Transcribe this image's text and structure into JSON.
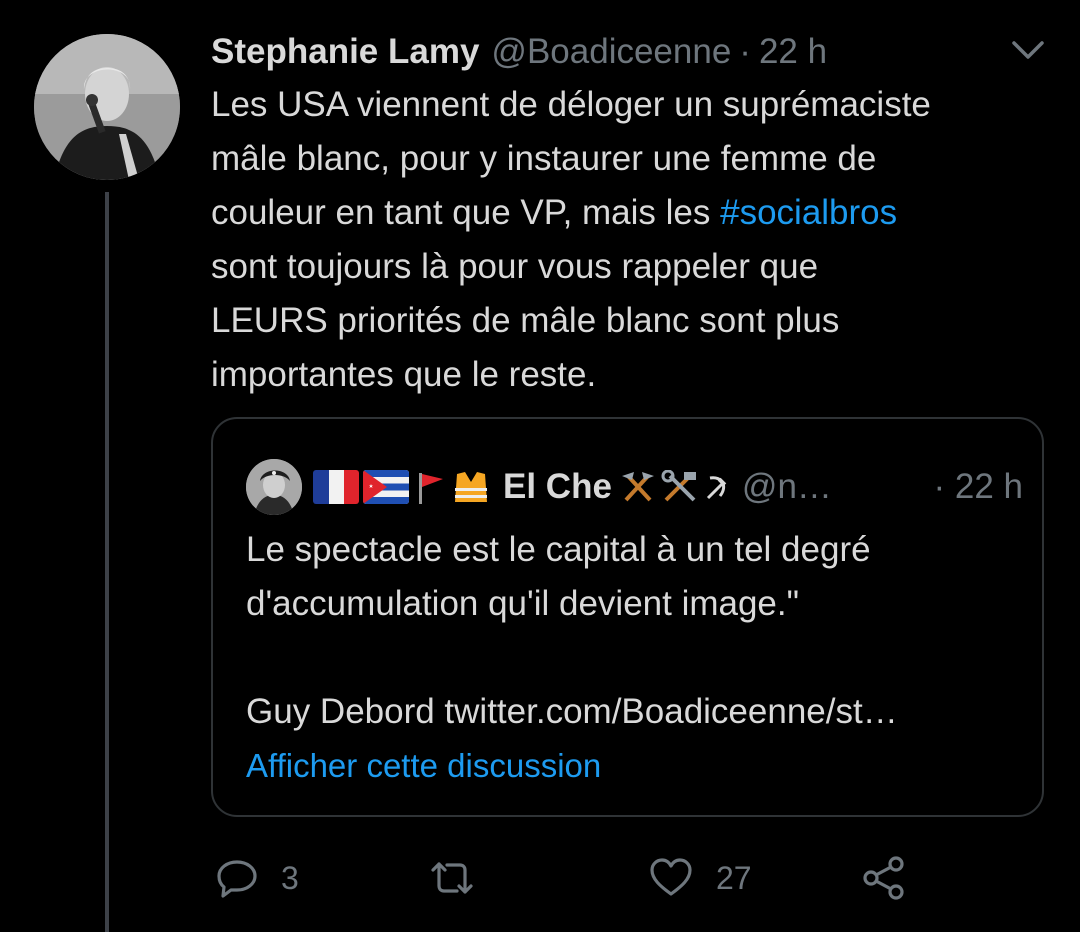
{
  "tweet": {
    "display_name": "Stephanie Lamy",
    "handle": "@Boadiceenne",
    "separator": "·",
    "time": "22 h",
    "text_lines": [
      "Les USA viennent de déloger un suprémaciste",
      "mâle blanc, pour y instaurer une femme de",
      "couleur en tant que VP, mais les ",
      "sont toujours là pour vous rappeler que",
      "LEURS priorités de mâle blanc sont plus",
      "importantes que le reste."
    ],
    "hashtag": "#socialbros"
  },
  "quote": {
    "flags": [
      "🇫🇷",
      "🇨🇺",
      "🚩",
      "🦺"
    ],
    "display_name": "El Che",
    "name_suffix_icons": [
      "⚒️",
      "🛠️",
      "☭"
    ],
    "handle": "@n…",
    "separator": "·",
    "time": "22 h",
    "text_lines": [
      "Le spectacle est le capital à un tel degré",
      "d'accumulation qu'il devient image.\"",
      "",
      "Guy Debord twitter.com/Boadiceenne/st…"
    ],
    "show_thread_link": "Afficher cette discussion"
  },
  "actions": {
    "reply_count": "3",
    "retweet_count": "",
    "like_count": "27"
  },
  "colors": {
    "background": "#000000",
    "text": "#d9d9d9",
    "muted": "#6e767d",
    "accent": "#1d9bf0",
    "border": "#2f3336"
  },
  "icons": {
    "caret": "chevron-down-icon",
    "reply": "reply-icon",
    "retweet": "retweet-icon",
    "like": "heart-icon",
    "share": "share-icon"
  }
}
